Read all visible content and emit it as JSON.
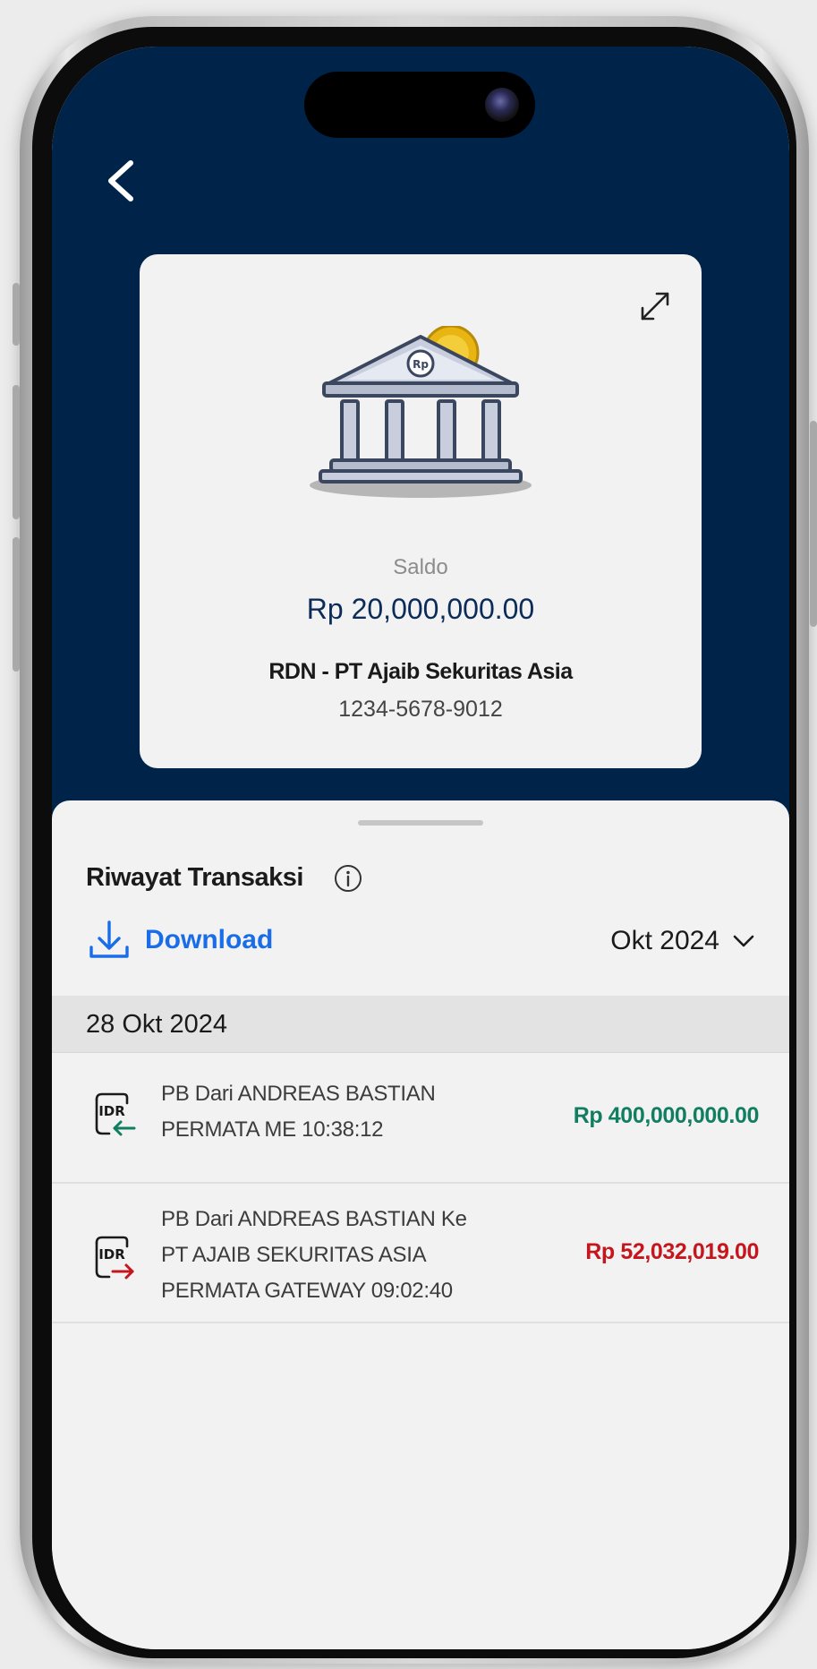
{
  "colors": {
    "header_bg": "#002449",
    "accent_blue": "#1a6de8",
    "credit_green": "#117e61",
    "debit_red": "#c5161d"
  },
  "icons": {
    "back": "chevron-left-icon",
    "expand": "expand-icon",
    "info": "info-icon",
    "download": "download-icon",
    "dropdown": "chevron-down-icon",
    "tx_in": "idr-incoming-icon",
    "tx_out": "idr-outgoing-icon"
  },
  "account": {
    "saldo_label": "Saldo",
    "saldo_value": "Rp 20,000,000.00",
    "name": "RDN - PT Ajaib Sekuritas Asia",
    "number": "1234-5678-9012"
  },
  "history": {
    "title": "Riwayat Transaksi",
    "download_label": "Download",
    "month_selected": "Okt 2024",
    "groups": [
      {
        "date": "28 Okt 2024",
        "transactions": [
          {
            "direction": "in",
            "line1": "PB Dari ANDREAS BASTIAN",
            "line2": "PERMATA ME 10:38:12",
            "amount": "Rp 400,000,000.00"
          },
          {
            "direction": "out",
            "line1": "PB Dari ANDREAS BASTIAN Ke",
            "line2": "PT AJAIB SEKURITAS ASIA",
            "line3": "PERMATA GATEWAY 09:02:40",
            "amount": "Rp 52,032,019.00"
          }
        ]
      }
    ]
  }
}
